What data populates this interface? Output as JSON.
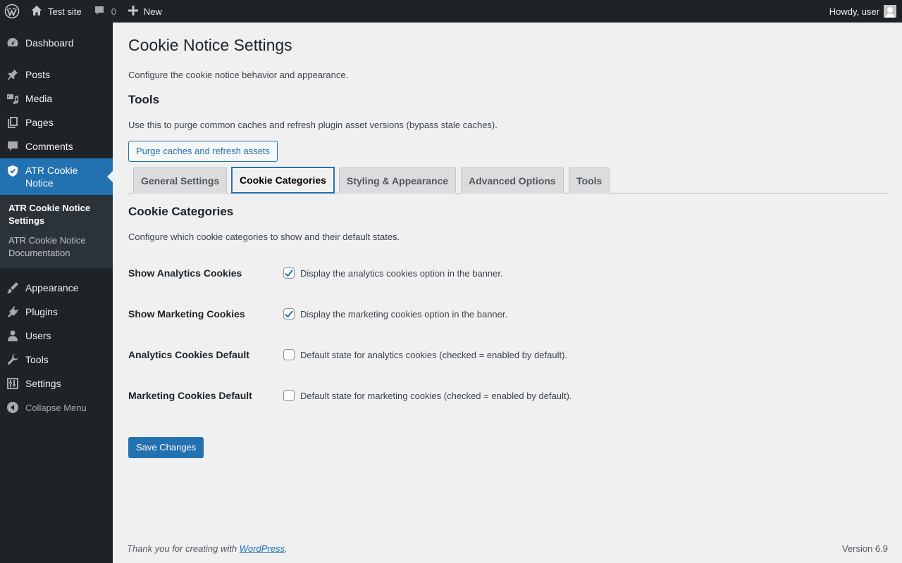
{
  "admin_bar": {
    "site_name": "Test site",
    "comments_count": "0",
    "new_label": "New",
    "greeting": "Howdy, user"
  },
  "sidebar": {
    "items": [
      {
        "label": "Dashboard",
        "icon": "dashboard-icon"
      },
      {
        "label": "Posts",
        "icon": "pin-icon"
      },
      {
        "label": "Media",
        "icon": "media-icon"
      },
      {
        "label": "Pages",
        "icon": "pages-icon"
      },
      {
        "label": "Comments",
        "icon": "comment-icon"
      },
      {
        "label": "ATR Cookie Notice",
        "icon": "shield-icon"
      },
      {
        "label": "Appearance",
        "icon": "brush-icon"
      },
      {
        "label": "Plugins",
        "icon": "plug-icon"
      },
      {
        "label": "Users",
        "icon": "user-icon"
      },
      {
        "label": "Tools",
        "icon": "wrench-icon"
      },
      {
        "label": "Settings",
        "icon": "settings-icon"
      }
    ],
    "submenu": [
      "ATR Cookie Notice Settings",
      "ATR Cookie Notice Documentation"
    ],
    "collapse_label": "Collapse Menu"
  },
  "page": {
    "title": "Cookie Notice Settings",
    "intro": "Configure the cookie notice behavior and appearance.",
    "tools_heading": "Tools",
    "tools_desc": "Use this to purge common caches and refresh plugin asset versions (bypass stale caches).",
    "purge_button": "Purge caches and refresh assets",
    "tabs": [
      "General Settings",
      "Cookie Categories",
      "Styling & Appearance",
      "Advanced Options",
      "Tools"
    ],
    "active_tab": "Cookie Categories",
    "section_heading": "Cookie Categories",
    "section_desc": "Configure which cookie categories to show and their default states.",
    "fields": [
      {
        "label": "Show Analytics Cookies",
        "desc": "Display the analytics cookies option in the banner.",
        "checked": true
      },
      {
        "label": "Show Marketing Cookies",
        "desc": "Display the marketing cookies option in the banner.",
        "checked": true
      },
      {
        "label": "Analytics Cookies Default",
        "desc": "Default state for analytics cookies (checked = enabled by default).",
        "checked": false
      },
      {
        "label": "Marketing Cookies Default",
        "desc": "Default state for marketing cookies (checked = enabled by default).",
        "checked": false
      }
    ],
    "save_button": "Save Changes"
  },
  "footer": {
    "thanks_prefix": "Thank you for creating with ",
    "thanks_link": "WordPress",
    "thanks_suffix": ".",
    "version": "Version 6.9"
  },
  "colors": {
    "admin_bar_bg": "#1d2327",
    "accent": "#2271b1",
    "page_bg": "#f0f0f1"
  }
}
